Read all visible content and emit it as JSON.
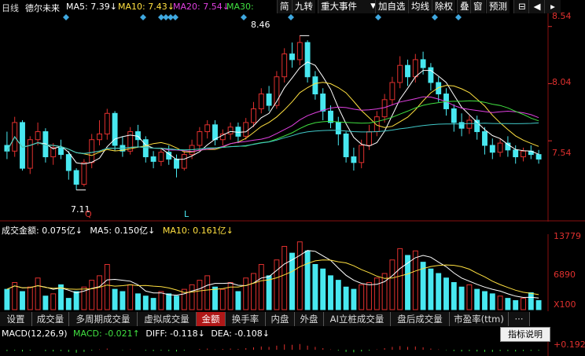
{
  "header": {
    "period_label": "日线",
    "stock_name": "德尔未来",
    "ma5": "MA5: 7.39↓",
    "ma10": "MA10: 7.43↓",
    "ma20": "MA20: 7.54↓",
    "ma30": "MA30:"
  },
  "toolbar": {
    "items": [
      "简",
      "九转",
      "重大事件",
      "加自选",
      "均线",
      "除权",
      "叠",
      "窗",
      "预测"
    ],
    "dropdown_icon": "caret-down-icon",
    "pin_icon": "pin-icon",
    "arrow_icon": "arrow-left-icon"
  },
  "price_axis": {
    "labels": [
      "8.54",
      "8.04",
      "7.54"
    ]
  },
  "annotations": {
    "high": "8.46",
    "low": "7.11",
    "marker_q": "Q",
    "marker_l": "L"
  },
  "volume_legend": {
    "amount": "成交金额: 0.075亿↓",
    "ma5": "MA5: 0.150亿↓",
    "ma10": "MA10: 0.161亿↓"
  },
  "volume_axis": {
    "labels": [
      "13779",
      "6890",
      "X100"
    ]
  },
  "tabs": [
    "设置",
    "成交量",
    "多周期成交量",
    "虚拟成交量",
    "金额",
    "换手率",
    "内盘",
    "外盘",
    "AI立桩成交量",
    "盘后成交量",
    "市盈率(ttm)",
    "···"
  ],
  "active_tab": "金额",
  "macd_legend": {
    "title": "MACD(12,26,9)",
    "macd": "MACD: -0.021↑",
    "diff": "DIFF: -0.118↓",
    "dea": "DEA: -0.108↓"
  },
  "macd_axis": {
    "labels": [
      "+0.192"
    ]
  },
  "tooltip": "指标说明",
  "colors": {
    "up": "#e0302e",
    "down": "#48e8f0",
    "ma5": "#ffffff",
    "ma10": "#ffe040",
    "ma20": "#e040e0",
    "ma30": "#40e040",
    "ma_long": "#40c8c8",
    "axis_text": "#e0302e",
    "diamond": "#3fa8e0"
  },
  "chart_data": {
    "type": "candlestick",
    "ylim": [
      6.95,
      8.6
    ],
    "high": 8.46,
    "low": 7.11,
    "candles": [
      [
        7.5,
        7.45,
        7.62,
        7.38
      ],
      [
        7.45,
        7.7,
        7.75,
        7.4
      ],
      [
        7.7,
        7.3,
        7.72,
        7.28
      ],
      [
        7.3,
        7.55,
        7.58,
        7.25
      ],
      [
        7.55,
        7.62,
        7.7,
        7.5
      ],
      [
        7.62,
        7.4,
        7.65,
        7.35
      ],
      [
        7.4,
        7.48,
        7.52,
        7.33
      ],
      [
        7.48,
        7.42,
        7.55,
        7.38
      ],
      [
        7.42,
        7.28,
        7.45,
        7.2
      ],
      [
        7.28,
        7.16,
        7.3,
        7.11
      ],
      [
        7.16,
        7.35,
        7.38,
        7.14
      ],
      [
        7.35,
        7.55,
        7.6,
        7.3
      ],
      [
        7.55,
        7.6,
        7.72,
        7.5
      ],
      [
        7.6,
        7.78,
        7.82,
        7.55
      ],
      [
        7.78,
        7.5,
        7.8,
        7.45
      ],
      [
        7.5,
        7.45,
        7.58,
        7.4
      ],
      [
        7.45,
        7.62,
        7.66,
        7.42
      ],
      [
        7.62,
        7.55,
        7.68,
        7.48
      ],
      [
        7.55,
        7.4,
        7.58,
        7.35
      ],
      [
        7.4,
        7.36,
        7.45,
        7.3
      ],
      [
        7.36,
        7.44,
        7.48,
        7.32
      ],
      [
        7.44,
        7.38,
        7.5,
        7.33
      ],
      [
        7.38,
        7.3,
        7.42,
        7.22
      ],
      [
        7.3,
        7.42,
        7.46,
        7.28
      ],
      [
        7.42,
        7.5,
        7.55,
        7.38
      ],
      [
        7.5,
        7.62,
        7.66,
        7.45
      ],
      [
        7.62,
        7.68,
        7.72,
        7.56
      ],
      [
        7.68,
        7.55,
        7.72,
        7.5
      ],
      [
        7.55,
        7.6,
        7.64,
        7.5
      ],
      [
        7.6,
        7.66,
        7.7,
        7.55
      ],
      [
        7.66,
        7.58,
        7.7,
        7.52
      ],
      [
        7.58,
        7.7,
        7.74,
        7.55
      ],
      [
        7.7,
        7.82,
        7.88,
        7.66
      ],
      [
        7.82,
        7.95,
        8.0,
        7.78
      ],
      [
        7.95,
        7.85,
        8.02,
        7.8
      ],
      [
        7.85,
        8.1,
        8.15,
        7.82
      ],
      [
        8.1,
        8.3,
        8.35,
        8.05
      ],
      [
        8.3,
        8.25,
        8.4,
        8.18
      ],
      [
        8.25,
        8.4,
        8.46,
        8.2
      ],
      [
        8.4,
        8.1,
        8.42,
        8.05
      ],
      [
        8.1,
        7.95,
        8.15,
        7.9
      ],
      [
        7.95,
        7.8,
        8.0,
        7.72
      ],
      [
        7.8,
        7.7,
        7.85,
        7.65
      ],
      [
        7.7,
        7.6,
        7.75,
        7.5
      ],
      [
        7.6,
        7.4,
        7.62,
        7.35
      ],
      [
        7.4,
        7.35,
        7.48,
        7.28
      ],
      [
        7.35,
        7.5,
        7.55,
        7.3
      ],
      [
        7.5,
        7.62,
        7.68,
        7.46
      ],
      [
        7.62,
        7.75,
        7.8,
        7.58
      ],
      [
        7.75,
        7.9,
        7.95,
        7.7
      ],
      [
        7.9,
        8.05,
        8.1,
        7.85
      ],
      [
        8.05,
        8.2,
        8.28,
        8.0
      ],
      [
        8.2,
        8.1,
        8.25,
        8.02
      ],
      [
        8.1,
        8.25,
        8.3,
        8.05
      ],
      [
        8.25,
        8.18,
        8.32,
        8.12
      ],
      [
        8.18,
        8.05,
        8.22,
        7.98
      ],
      [
        8.05,
        7.95,
        8.1,
        7.88
      ],
      [
        7.95,
        7.82,
        8.0,
        7.76
      ],
      [
        7.82,
        7.7,
        7.86,
        7.62
      ],
      [
        7.7,
        7.65,
        7.78,
        7.58
      ],
      [
        7.65,
        7.72,
        7.76,
        7.6
      ],
      [
        7.72,
        7.62,
        7.76,
        7.55
      ],
      [
        7.62,
        7.5,
        7.66,
        7.42
      ],
      [
        7.5,
        7.44,
        7.56,
        7.38
      ],
      [
        7.44,
        7.52,
        7.56,
        7.4
      ],
      [
        7.52,
        7.46,
        7.58,
        7.4
      ],
      [
        7.46,
        7.4,
        7.5,
        7.34
      ],
      [
        7.4,
        7.45,
        7.48,
        7.36
      ],
      [
        7.45,
        7.42,
        7.5,
        7.38
      ],
      [
        7.42,
        7.38,
        7.46,
        7.34
      ]
    ],
    "volume": [
      0.09,
      0.12,
      0.08,
      0.1,
      0.14,
      0.06,
      0.07,
      0.11,
      0.05,
      0.08,
      0.1,
      0.13,
      0.15,
      0.2,
      0.09,
      0.08,
      0.11,
      0.07,
      0.06,
      0.05,
      0.08,
      0.07,
      0.06,
      0.09,
      0.11,
      0.13,
      0.15,
      0.1,
      0.09,
      0.12,
      0.08,
      0.14,
      0.16,
      0.2,
      0.15,
      0.22,
      0.28,
      0.25,
      0.3,
      0.26,
      0.2,
      0.18,
      0.15,
      0.13,
      0.1,
      0.09,
      0.11,
      0.12,
      0.14,
      0.16,
      0.22,
      0.27,
      0.24,
      0.26,
      0.21,
      0.18,
      0.16,
      0.14,
      0.12,
      0.1,
      0.11,
      0.09,
      0.08,
      0.07,
      0.06,
      0.05,
      0.04,
      0.05,
      0.075,
      0.04
    ],
    "vol_ylim": [
      0,
      0.32
    ],
    "macd_ylim": [
      -0.15,
      0.192
    ],
    "macd": [
      -0.03,
      -0.02,
      -0.04,
      -0.02,
      0.0,
      -0.03,
      -0.04,
      -0.03,
      -0.05,
      -0.07,
      -0.05,
      -0.02,
      0.01,
      0.03,
      0.0,
      -0.01,
      0.01,
      0.0,
      -0.02,
      -0.03,
      -0.02,
      -0.03,
      -0.04,
      -0.02,
      0.0,
      0.02,
      0.03,
      0.01,
      0.02,
      0.03,
      0.02,
      0.04,
      0.06,
      0.08,
      0.07,
      0.1,
      0.13,
      0.12,
      0.14,
      0.1,
      0.07,
      0.04,
      0.01,
      -0.02,
      -0.05,
      -0.06,
      -0.04,
      -0.02,
      0.01,
      0.04,
      0.07,
      0.09,
      0.07,
      0.08,
      0.06,
      0.03,
      0.01,
      -0.01,
      -0.03,
      -0.04,
      -0.03,
      -0.04,
      -0.05,
      -0.05,
      -0.03,
      -0.03,
      -0.04,
      -0.03,
      -0.025,
      -0.021
    ]
  }
}
